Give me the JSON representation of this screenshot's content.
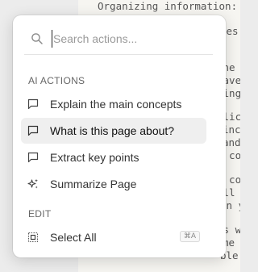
{
  "document": {
    "lines": [
      "Organizing information: Ma",
      "",
      "ies.",
      "",
      "Whe",
      "rave",
      "king",
      "",
      "plic",
      "inc",
      "and",
      "e co",
      "",
      "e co",
      "ell a",
      "in y",
      "",
      "es w",
      "me",
      "ble"
    ]
  },
  "palette": {
    "search": {
      "placeholder": "Search actions..."
    },
    "sections": [
      {
        "label": "AI ACTIONS",
        "items": [
          {
            "label": "Explain the main concepts",
            "icon": "chat-bubble-icon"
          },
          {
            "label": "What is this page about?",
            "icon": "chat-bubble-icon",
            "active": true
          },
          {
            "label": "Extract key points",
            "icon": "chat-bubble-icon"
          },
          {
            "label": "Summarize Page",
            "icon": "sparkle-icon"
          }
        ]
      },
      {
        "label": "EDIT",
        "items": [
          {
            "label": "Select All",
            "icon": "select-all-icon",
            "shortcut": "⌘A"
          }
        ]
      }
    ]
  }
}
